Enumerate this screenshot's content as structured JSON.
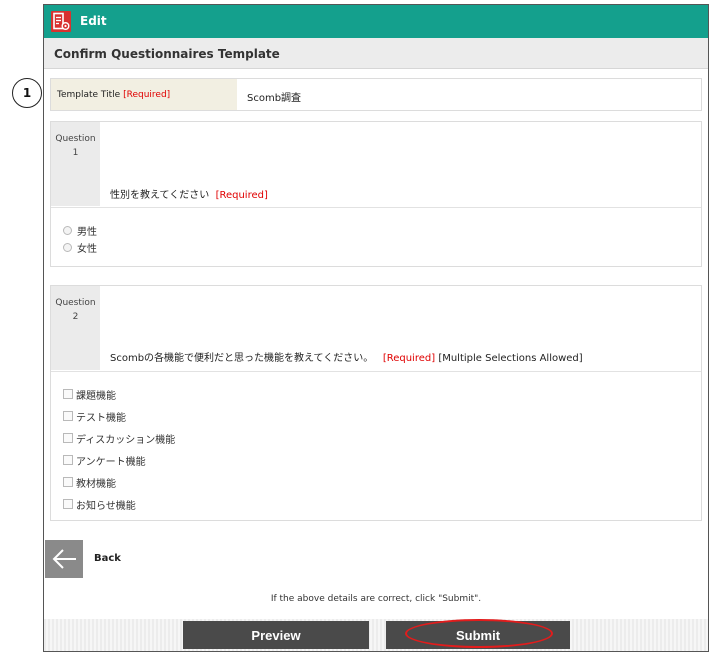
{
  "header": {
    "title": "Edit",
    "icon": "edit-document-icon",
    "color": "#14a08d",
    "icon_color": "#d8322f"
  },
  "subheader": {
    "title": "Confirm Questionnaires Template"
  },
  "callout": {
    "number": "1"
  },
  "template_title": {
    "label": "Template Title",
    "required": "[Required]",
    "value": "Scomb調査"
  },
  "questions": [
    {
      "label": "Question",
      "number": "1",
      "text": "性別を教えてください",
      "required": "[Required]",
      "type": "radio",
      "options": [
        "男性",
        "女性"
      ]
    },
    {
      "label": "Question",
      "number": "2",
      "text": "Scombの各機能で便利だと思った機能を教えてください。",
      "required": "[Required]",
      "extra": "[Multiple Selections Allowed]",
      "type": "checkbox",
      "options": [
        "課題機能",
        "テスト機能",
        "ディスカッション機能",
        "アンケート機能",
        "教材機能",
        "お知らせ機能"
      ]
    }
  ],
  "back": {
    "label": "Back",
    "icon": "back-arrow-icon"
  },
  "confirm_text": "If the above details are correct, click \"Submit\".",
  "buttons": {
    "preview": "Preview",
    "submit": "Submit"
  },
  "colors": {
    "required": "#e00000",
    "highlight": "#e21c1c",
    "button_bg": "#4a4a4a"
  }
}
